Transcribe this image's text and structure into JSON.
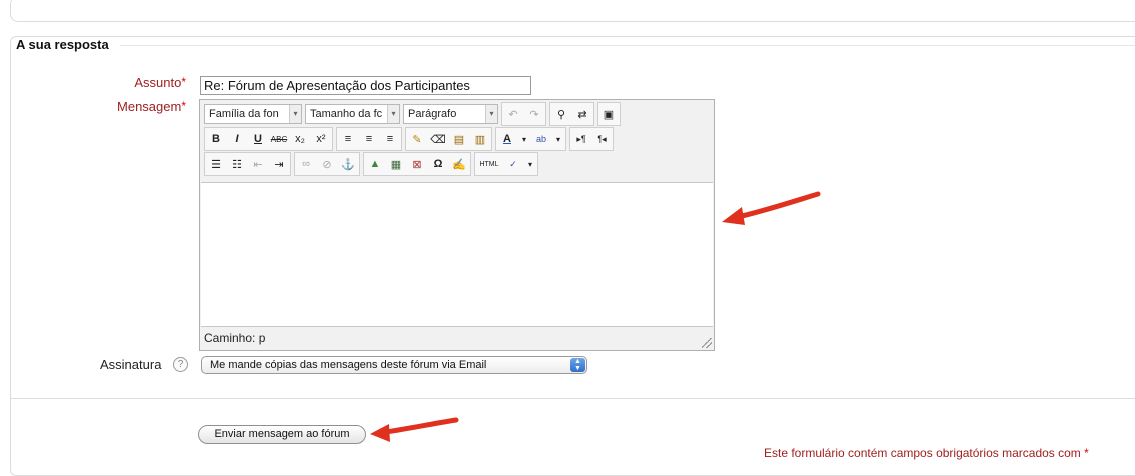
{
  "section": {
    "legend": "A sua resposta"
  },
  "fields": {
    "subject_label": "Assunto",
    "subject_value": "Re: Fórum de Apresentação dos Participantes",
    "message_label": "Mensagem",
    "required_mark": "*",
    "signature_label": "Assinatura"
  },
  "editor": {
    "font_family": "Família da fon",
    "font_size": "Tamanho da fc",
    "format": "Parágrafo",
    "path": "Caminho: p"
  },
  "subscription": {
    "selected": "Me mande cópias das mensagens deste fórum via Email"
  },
  "submit_label": "Enviar mensagem ao fórum",
  "required_note": "Este formulário contém campos obrigatórios marcados com",
  "colors": {
    "required": "#dd0000",
    "label": "#a02020",
    "arrow": "#e0301e"
  }
}
